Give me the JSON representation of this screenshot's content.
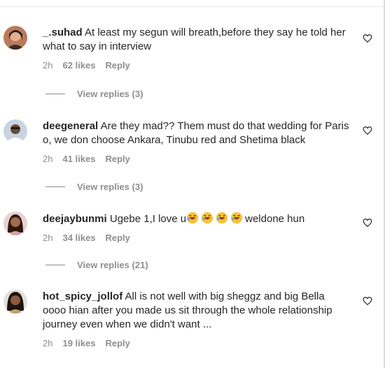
{
  "comments": [
    {
      "username": "_.suhad",
      "text": "At least my segun will breath,before they say he told her what to say in interview",
      "time": "2h",
      "likes": "62 likes",
      "reply_label": "Reply",
      "view_replies": "View replies (3)"
    },
    {
      "username": "deegeneral",
      "text": "Are they mad?? Them must do that wedding for Paris o, we don choose Ankara, Tinubu red and Shetima black",
      "time": "2h",
      "likes": "41 likes",
      "reply_label": "Reply",
      "view_replies": "View replies (3)"
    },
    {
      "username": "deejaybunmi",
      "text_before": "Ugebe 1,I love u",
      "emoji": [
        "rolling-on-floor-laughing",
        "rolling-on-floor-laughing",
        "rolling-on-floor-laughing",
        "rolling-on-floor-laughing"
      ],
      "text_after": "weldone hun",
      "time": "2h",
      "likes": "34 likes",
      "reply_label": "Reply",
      "view_replies": "View replies (21)"
    },
    {
      "username": "hot_spicy_jollof",
      "text": "All is not well with big sheggz and big Bella oooo hian after you made us sit through the whole relationship journey even when we didn't want ...",
      "time": "2h",
      "likes": "19 likes",
      "reply_label": "Reply"
    }
  ],
  "colors": {
    "primary_text": "#262626",
    "secondary_text": "#8e8e8e",
    "emoji_yellow": "#f6c23a"
  },
  "icons": {
    "like": "heart-outline-icon"
  }
}
